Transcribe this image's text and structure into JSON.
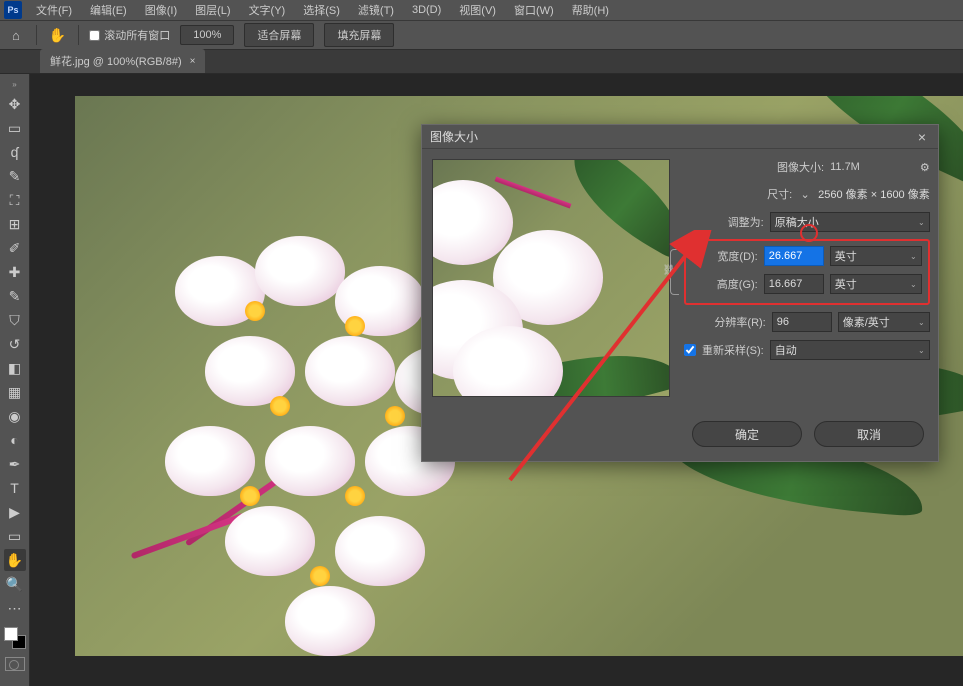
{
  "menu": {
    "items": [
      "文件(F)",
      "编辑(E)",
      "图像(I)",
      "图层(L)",
      "文字(Y)",
      "选择(S)",
      "滤镜(T)",
      "3D(D)",
      "视图(V)",
      "窗口(W)",
      "帮助(H)"
    ]
  },
  "options": {
    "scroll_all_windows": "滚动所有窗口",
    "zoom_value": "100%",
    "fit_screen": "适合屏幕",
    "fill_screen": "填充屏幕"
  },
  "tab": {
    "label": "鲜花.jpg @ 100%(RGB/8#)"
  },
  "dialog": {
    "title": "图像大小",
    "image_size_label": "图像大小:",
    "image_size_value": "11.7M",
    "dimensions_label": "尺寸:",
    "dimensions_value": "2560 像素 × 1600 像素",
    "fit_to_label": "调整为:",
    "fit_to_value": "原稿大小",
    "width_label": "宽度(D):",
    "width_value": "26.667",
    "width_unit": "英寸",
    "height_label": "高度(G):",
    "height_value": "16.667",
    "height_unit": "英寸",
    "resolution_label": "分辨率(R):",
    "resolution_value": "96",
    "resolution_unit": "像素/英寸",
    "resample_label": "重新采样(S):",
    "resample_value": "自动",
    "ok": "确定",
    "cancel": "取消"
  }
}
